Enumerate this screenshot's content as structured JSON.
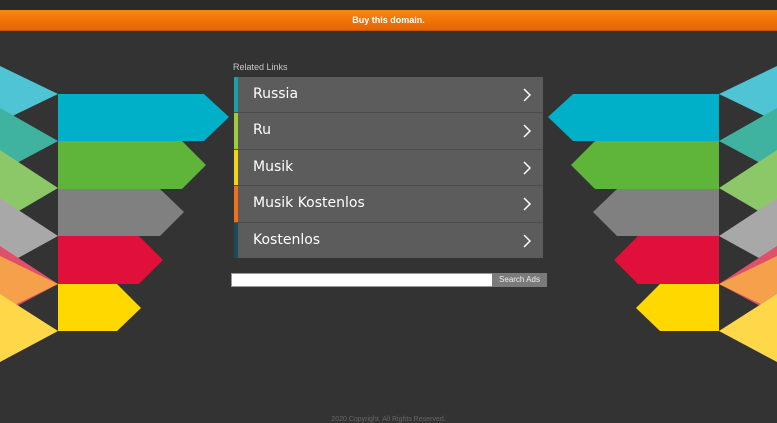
{
  "header": {
    "buy_label": "Buy this domain."
  },
  "related": {
    "title": "Related Links",
    "items": [
      {
        "label": "Russia",
        "accent": "#1aa0a8"
      },
      {
        "label": "Ru",
        "accent": "#9ccd3c"
      },
      {
        "label": "Musik",
        "accent": "#f3d31a"
      },
      {
        "label": "Musik Kostenlos",
        "accent": "#f36f1a"
      },
      {
        "label": "Kostenlos",
        "accent": "#1b4a5a"
      }
    ]
  },
  "search": {
    "value": "",
    "button_label": "Search Ads"
  },
  "footer": {
    "text": "2020 Copyright. All Rights Reserved."
  },
  "colors": {
    "background": "#333333",
    "bar_orange": "#f57a0a",
    "deco": [
      "#00b0c8",
      "#5fb43a",
      "#808080",
      "#e0103a",
      "#ffd800"
    ]
  }
}
